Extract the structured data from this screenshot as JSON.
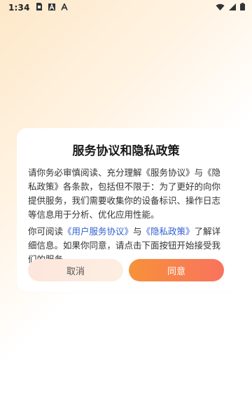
{
  "status_bar": {
    "time": "1:34",
    "icons": [
      "sim-notification-icon",
      "a-app-icon",
      "a-app-icon-2",
      "wifi-icon",
      "cellular-signal-icon",
      "battery-icon"
    ]
  },
  "dialog": {
    "title": "服务协议和隐私政策",
    "paragraph1": "请你务必审慎阅读、充分理解《服务协议》与《隐私政策》各条款，包括但不限于：为了更好的向你提供服务，我们需要收集你的设备标识、操作日志等信息用于分析、优化应用性能。",
    "paragraph2_prefix": "你可阅读",
    "user_agreement_link": "《用户服务协议》",
    "paragraph2_mid": "与",
    "privacy_policy_link": "《隐私政策》",
    "paragraph2_suffix": "了解详细信息。如果你同意，请点击下面按钮开始接受我们的服务。",
    "cancel_label": "取消",
    "agree_label": "同意"
  },
  "colors": {
    "link": "#2f5fd0",
    "agree_gradient_start": "#f7913a",
    "agree_gradient_end": "#f9735e",
    "cancel_bg": "#fde6dc"
  }
}
